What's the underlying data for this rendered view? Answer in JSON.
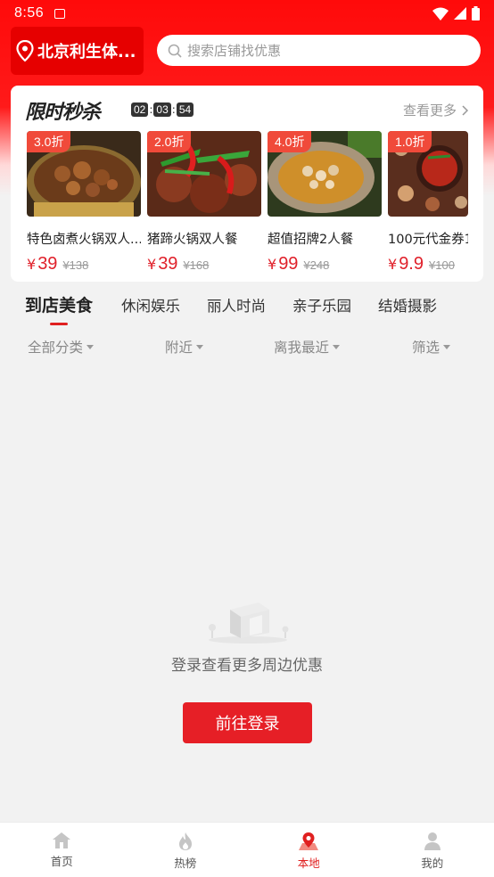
{
  "status_bar": {
    "time": "8:56"
  },
  "header": {
    "location": "北京利生体...",
    "search_placeholder": "搜索店铺找优惠"
  },
  "flash_sale": {
    "title": "限时秒杀",
    "timer": [
      "02",
      "03",
      "54"
    ],
    "see_more": "查看更多",
    "deals": [
      {
        "discount": "3.0折",
        "name": "特色卤煮火锅双人...",
        "currency": "¥",
        "price": "39",
        "original_price": "¥138"
      },
      {
        "discount": "2.0折",
        "name": "猪蹄火锅双人餐",
        "currency": "¥",
        "price": "39",
        "original_price": "¥168"
      },
      {
        "discount": "4.0折",
        "name": "超值招牌2人餐",
        "currency": "¥",
        "price": "99",
        "original_price": "¥248"
      },
      {
        "discount": "1.0折",
        "name": "100元代金券1",
        "currency": "¥",
        "price": "9.9",
        "original_price": "¥100"
      }
    ]
  },
  "categories": [
    "到店美食",
    "休闲娱乐",
    "丽人时尚",
    "亲子乐园",
    "结婚摄影"
  ],
  "filters": [
    "全部分类",
    "附近",
    "离我最近",
    "筛选"
  ],
  "empty_state": {
    "message": "登录查看更多周边优惠",
    "button": "前往登录"
  },
  "tabbar": [
    {
      "label": "首页",
      "icon": "home-icon"
    },
    {
      "label": "热榜",
      "icon": "fire-icon"
    },
    {
      "label": "本地",
      "icon": "map-pin-icon",
      "active": true
    },
    {
      "label": "我的",
      "icon": "user-icon"
    }
  ],
  "colors": {
    "brand": "#e61f26",
    "header_bg": "#ff0a0a",
    "price": "#e0202a"
  }
}
